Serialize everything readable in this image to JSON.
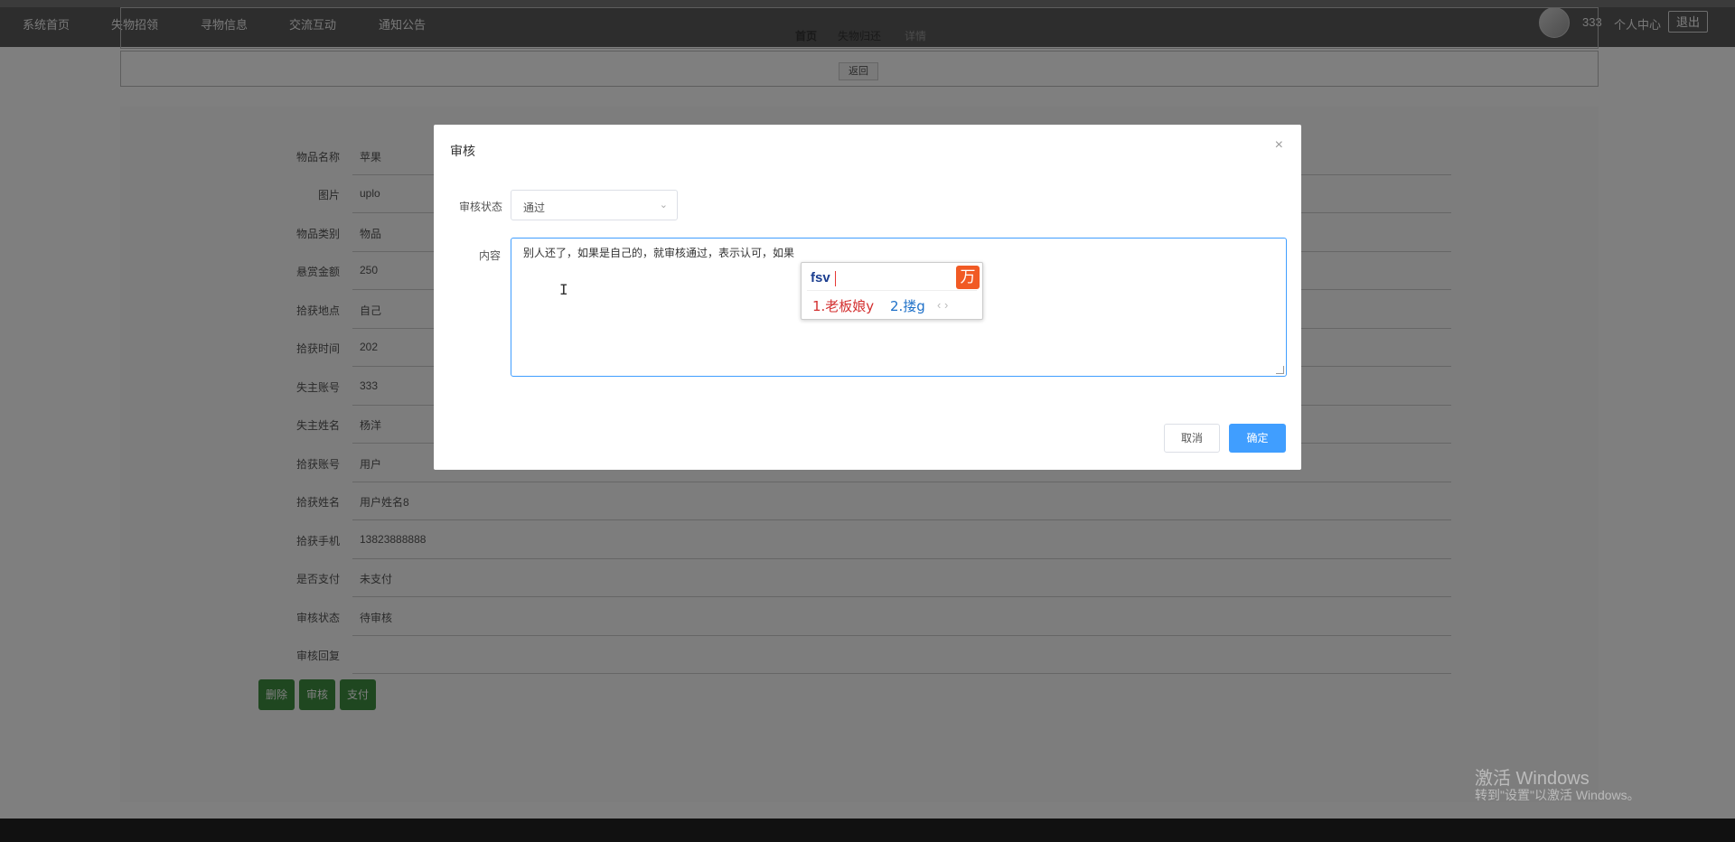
{
  "nav": {
    "items": [
      "系统首页",
      "失物招领",
      "寻物信息",
      "交流互动",
      "通知公告"
    ],
    "username": "333",
    "profile": "个人中心",
    "logout": "退出"
  },
  "breadcrumb": [
    "首页",
    "失物归还",
    "详情"
  ],
  "back_label": "返回",
  "detail": {
    "rows": [
      {
        "label": "物品名称",
        "value": "苹果"
      },
      {
        "label": "图片",
        "value": "uplo"
      },
      {
        "label": "物品类别",
        "value": "物品"
      },
      {
        "label": "悬赏金额",
        "value": "250"
      },
      {
        "label": "拾获地点",
        "value": "自己"
      },
      {
        "label": "拾获时间",
        "value": "202"
      },
      {
        "label": "失主账号",
        "value": "333"
      },
      {
        "label": "失主姓名",
        "value": "杨洋"
      },
      {
        "label": "拾获账号",
        "value": "用户"
      },
      {
        "label": "拾获姓名",
        "value": "用户姓名8"
      },
      {
        "label": "拾获手机",
        "value": "13823888888"
      },
      {
        "label": "是否支付",
        "value": "未支付"
      },
      {
        "label": "审核状态",
        "value": "待审核"
      },
      {
        "label": "审核回复",
        "value": ""
      }
    ],
    "buttons": {
      "delete": "删除",
      "review": "审核",
      "pay": "支付"
    }
  },
  "dialog": {
    "title": "审核",
    "close": "×",
    "status_label": "审核状态",
    "status_value": "通过",
    "content_label": "内容",
    "content_value": "别人还了，如果是自己的，就审核通过，表示认可，如果",
    "cancel": "取消",
    "confirm": "确定"
  },
  "ime": {
    "code": "fsv",
    "candidate1": "1.老板娘y",
    "candidate2": "2.搂g",
    "pager": "‹ ›"
  },
  "watermark": {
    "title": "激活 Windows",
    "subtitle": "转到\"设置\"以激活 Windows。"
  }
}
